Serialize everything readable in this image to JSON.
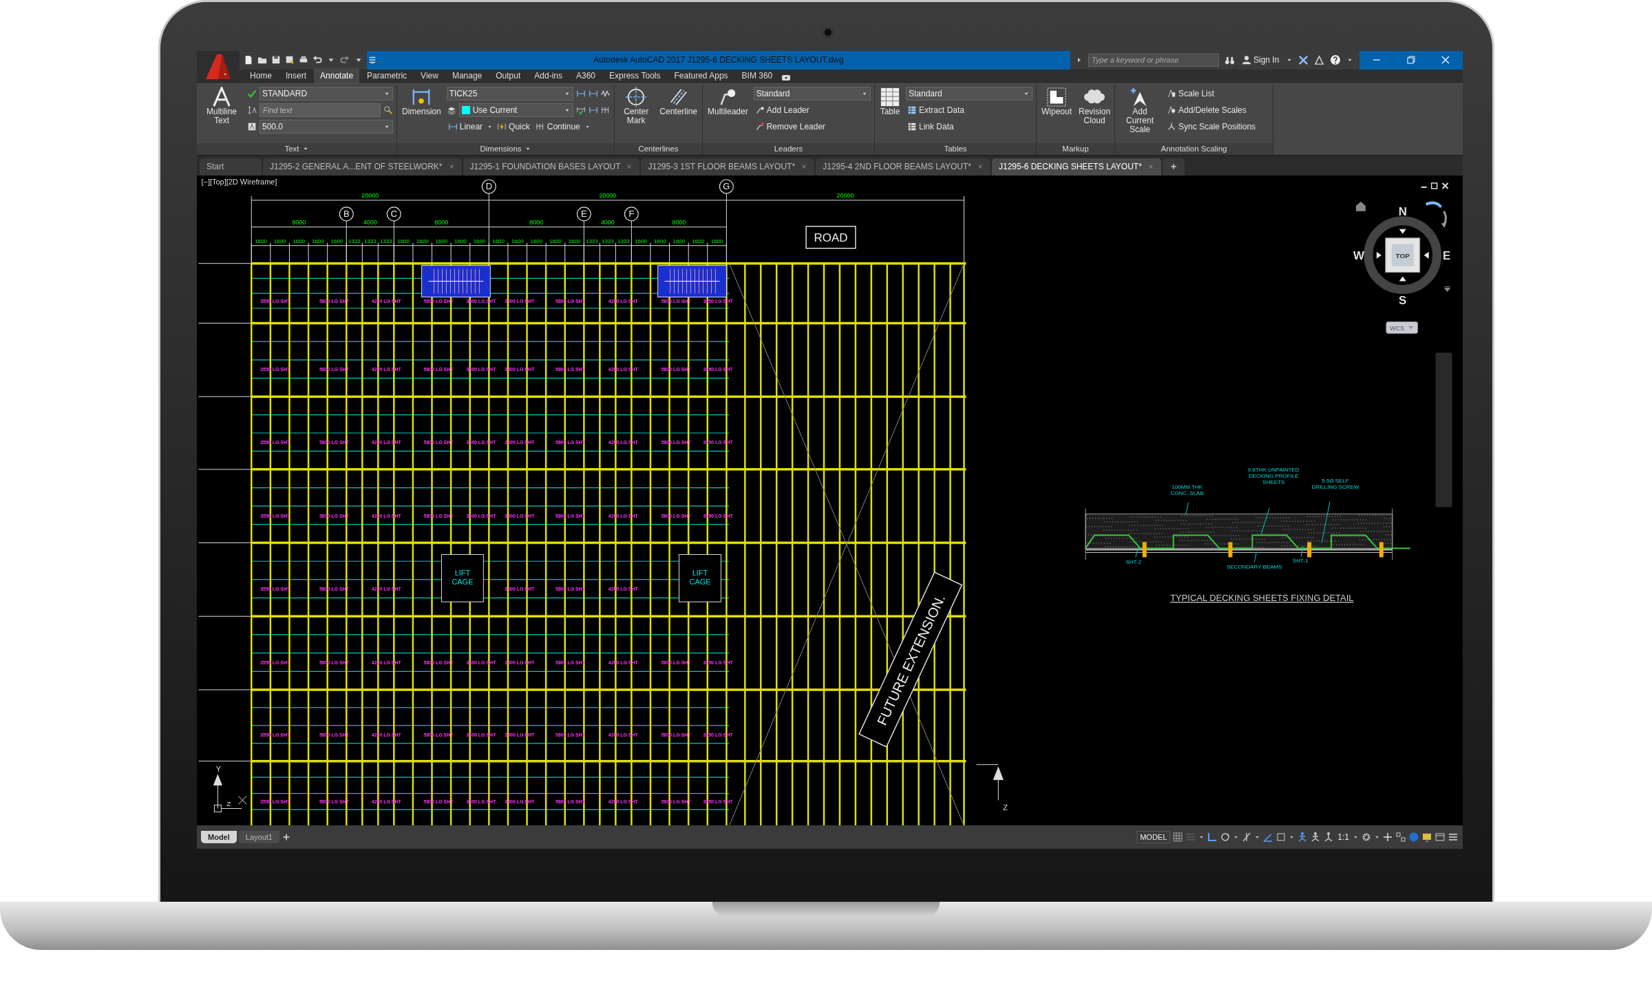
{
  "window": {
    "title": "Autodesk AutoCAD 2017   J1295-6  DECKING SHEETS LAYOUT.dwg",
    "search": {
      "placeholder": "Type a keyword or phrase"
    },
    "account": "Sign In"
  },
  "ribbon_tabs": [
    {
      "label": "Home",
      "selected": false
    },
    {
      "label": "Insert",
      "selected": false
    },
    {
      "label": "Annotate",
      "selected": true
    },
    {
      "label": "Parametric",
      "selected": false
    },
    {
      "label": "View",
      "selected": false
    },
    {
      "label": "Manage",
      "selected": false
    },
    {
      "label": "Output",
      "selected": false
    },
    {
      "label": "Add-ins",
      "selected": false
    },
    {
      "label": "A360",
      "selected": false
    },
    {
      "label": "Express Tools",
      "selected": false
    },
    {
      "label": "Featured Apps",
      "selected": false
    },
    {
      "label": "BIM 360",
      "selected": false
    }
  ],
  "ribbon_panels": [
    {
      "title": "Text",
      "groups": [
        {
          "kind": "large",
          "label": "Multiline Text"
        },
        {
          "kind": "stack",
          "rows": [
            {
              "kind": "dropdown",
              "value": "STANDARD"
            },
            {
              "kind": "field",
              "placeholder": "Find text"
            },
            {
              "kind": "dropdown",
              "value": "500.0"
            }
          ]
        }
      ]
    },
    {
      "title": "Dimensions",
      "groups": [
        {
          "kind": "large",
          "label": "Dimension"
        },
        {
          "kind": "stack",
          "rows": [
            {
              "kind": "dropdown",
              "value": "TICK25"
            },
            {
              "kind": "dropdown",
              "value": "Use Current",
              "color": "#00ffff"
            },
            {
              "kind": "buttons",
              "labels": [
                "Linear",
                "Quick",
                "Continue"
              ]
            }
          ]
        }
      ]
    },
    {
      "title": "Centerlines",
      "groups": [
        {
          "kind": "large",
          "label": "Center Mark"
        },
        {
          "kind": "large",
          "label": "Centerline"
        }
      ]
    },
    {
      "title": "Leaders",
      "groups": [
        {
          "kind": "large",
          "label": "Multileader"
        },
        {
          "kind": "stack",
          "rows": [
            {
              "kind": "dropdown",
              "value": "Standard"
            },
            {
              "kind": "buttons",
              "labels": [
                "Add Leader"
              ]
            },
            {
              "kind": "buttons",
              "labels": [
                "Remove Leader"
              ]
            }
          ]
        }
      ]
    },
    {
      "title": "Tables",
      "groups": [
        {
          "kind": "large",
          "label": "Table"
        },
        {
          "kind": "stack",
          "rows": [
            {
              "kind": "dropdown",
              "value": "Standard"
            },
            {
              "kind": "buttons",
              "labels": [
                "Extract Data"
              ]
            },
            {
              "kind": "buttons",
              "labels": [
                "Link Data"
              ]
            }
          ]
        }
      ]
    },
    {
      "title": "Markup",
      "groups": [
        {
          "kind": "large",
          "label": "Wipeout"
        },
        {
          "kind": "large",
          "label": "Revision Cloud"
        }
      ]
    },
    {
      "title": "Annotation Scaling",
      "groups": [
        {
          "kind": "large",
          "label": "Add Current Scale"
        },
        {
          "kind": "stack",
          "rows": [
            {
              "kind": "buttons",
              "labels": [
                "Scale List"
              ]
            },
            {
              "kind": "buttons",
              "labels": [
                "Add/Delete Scales"
              ]
            },
            {
              "kind": "buttons",
              "labels": [
                "Sync Scale Positions"
              ]
            }
          ]
        }
      ]
    }
  ],
  "file_tabs": [
    {
      "label": "Start",
      "selected": false
    },
    {
      "label": "J1295-2 GENERAL A...ENT OF STEELWORK*",
      "selected": false
    },
    {
      "label": "J1295-1 FOUNDATION BASES LAYOUT",
      "selected": false
    },
    {
      "label": "J1295-3 1ST FLOOR  BEAMS LAYOUT*",
      "selected": false
    },
    {
      "label": "J1295-4 2ND FLOOR  BEAMS LAYOUT*",
      "selected": false
    },
    {
      "label": "J1295-6  DECKING SHEETS LAYOUT*",
      "selected": true
    }
  ],
  "viewport_label": "[−][Top][2D Wireframe]",
  "drawing": {
    "grid_labels": [
      "B",
      "C",
      "D",
      "E",
      "F",
      "G"
    ],
    "overall_dims": [
      "20000",
      "20000",
      "20000"
    ],
    "bay_dims": [
      "8000",
      "4000",
      "8000",
      "8000",
      "4000",
      "8000"
    ],
    "spacing_dims": [
      "1600",
      "1600",
      "1600",
      "1600",
      "1600",
      "1333",
      "1333",
      "1333",
      "1600",
      "1600",
      "1600",
      "1600",
      "1600",
      "1600",
      "1600",
      "1600",
      "1600",
      "1600",
      "1333",
      "1333",
      "1333",
      "1600",
      "1600",
      "1600",
      "1600",
      "1600"
    ],
    "road": "ROAD",
    "lift_cages": [
      {
        "lines": [
          "LIFT",
          "CAGE"
        ]
      },
      {
        "lines": [
          "LIFT",
          "CAGE"
        ]
      }
    ],
    "future": "FUTURE  EXTENSION.",
    "ucs_left": [
      "Y",
      "Z"
    ],
    "ucs_right": [
      "Z"
    ],
    "sheet_label_rows": [
      [
        "3550 LG SHT",
        "5800 LG SHT",
        "4200 LG SHT",
        "5800 LG SHT",
        "3400 LG SHT",
        "3400 LG SHT",
        "5800 LG SHT",
        "4200 LG SHT",
        "5800 LG SHT",
        "3550 LG SHT"
      ],
      [
        "3550 LG SHT",
        "5800 LG SHT",
        "4200 LG SHT",
        "5800 LG SHT",
        "3400 LG SHT",
        "3400 LG SHT",
        "5800 LG SHT",
        "4200 LG SHT",
        "5800 LG SHT",
        "3550 LG SHT"
      ],
      [
        "3550 LG SHT",
        "5800 LG SHT",
        "4200 LG SHT",
        "5800 LG SHT",
        "3400 LG SHT",
        "3400 LG SHT",
        "5800 LG SHT",
        "4200 LG SHT",
        "5800 LG SHT",
        "3550 LG SHT"
      ],
      [
        "3550 LG SHT",
        "5800 LG SHT",
        "4200 LG SHT",
        "5800 LG SHT",
        "3400 LG SHT",
        "3400 LG SHT",
        "5800 LG SHT",
        "4200 LG SHT",
        "5800 LG SHT",
        "3550 LG SHT"
      ],
      [
        "3550 LG SHT",
        "5800 LG SHT",
        "4200 LG SHT",
        "3400 LG SHT",
        "5800 LG SHT",
        "4200 LG SHT"
      ],
      [
        "3550 LG SHT",
        "5800 LG SHT",
        "4200 LG SHT",
        "5800 LG SHT",
        "3400 LG SHT",
        "3400 LG SHT",
        "5800 LG SHT",
        "4200 LG SHT",
        "5800 LG SHT",
        "3550 LG SHT"
      ],
      [
        "3550 LG SHT",
        "5800 LG SHT",
        "4200 LG SHT",
        "5800 LG SHT",
        "3400 LG SHT",
        "3400 LG SHT",
        "5800 LG SHT",
        "4200 LG SHT",
        "5800 LG SHT",
        "3550 LG SHT"
      ],
      [
        "3550 LG SHT",
        "5800 LG SHT",
        "4200 LG SHT",
        "5800 LG SHT",
        "3400 LG SHT",
        "3400 LG SHT",
        "5800 LG SHT",
        "4200 LG SHT",
        "5800 LG SHT",
        "3550 LG SHT"
      ]
    ]
  },
  "detail": {
    "callouts": [
      {
        "lines": [
          "100MM THK",
          "CONC. SLAB"
        ]
      },
      {
        "lines": [
          "0.8THK UNPAINTED",
          "DECKING PROFILE",
          "SHEETS"
        ]
      },
      {
        "lines": [
          "5.5Ø SELF",
          "DRILLING SCREW"
        ]
      },
      {
        "lines": [
          "SHT-2"
        ]
      },
      {
        "lines": [
          "SECONDARY BEAMS"
        ]
      },
      {
        "lines": [
          "SHT-1"
        ]
      }
    ],
    "title": "TYPICAL DECKING SHEETS FIXING DETAIL"
  },
  "viewcube": {
    "north": "N",
    "south": "S",
    "east": "E",
    "west": "W",
    "face": "TOP",
    "ucs": "WCS"
  },
  "layout_tabs": [
    {
      "label": "Model",
      "selected": true
    },
    {
      "label": "Layout1",
      "selected": false
    }
  ],
  "status_bar": {
    "mode": "MODEL",
    "scale": "1:1"
  }
}
